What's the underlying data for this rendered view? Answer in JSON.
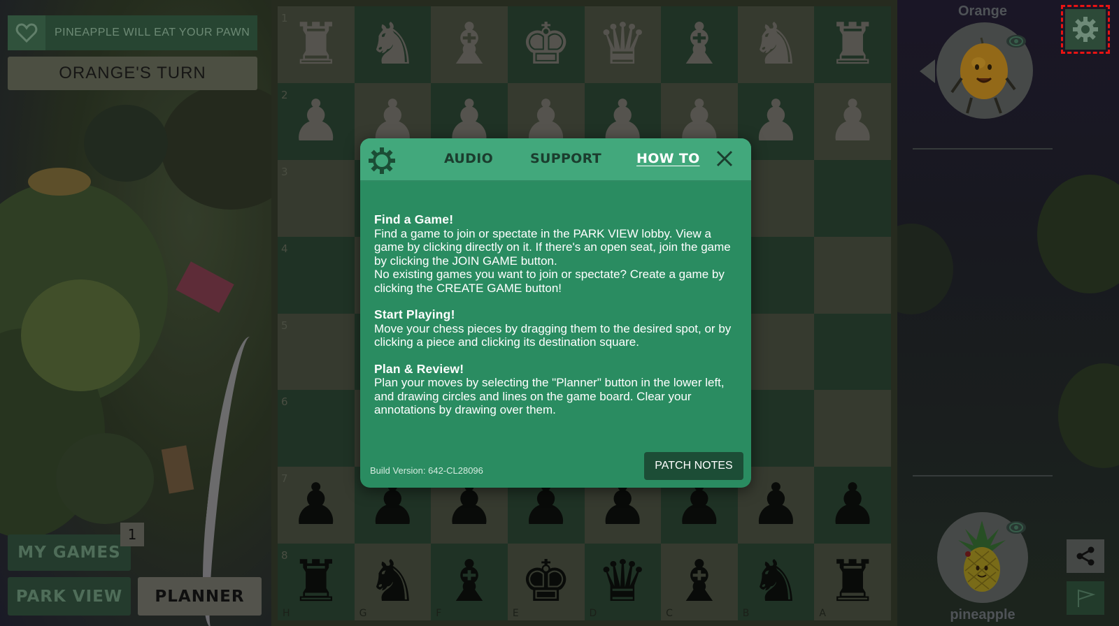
{
  "left_panel": {
    "notification_text": "PINEAPPLE WILL EAT YOUR PAWN",
    "turn_banner": "ORANGE'S TURN",
    "my_games_label": "MY GAMES",
    "my_games_count": "1",
    "park_view_label": "PARK VIEW",
    "planner_label": "PLANNER"
  },
  "board": {
    "ranks": [
      "1",
      "2",
      "3",
      "4",
      "5",
      "6",
      "7",
      "8"
    ],
    "files": [
      "H",
      "G",
      "F",
      "E",
      "D",
      "C",
      "B",
      "A"
    ],
    "rows": [
      [
        "♜w",
        "♞w",
        "♝w",
        "♚w",
        "♛w",
        "♝w",
        "♞w",
        "♜w"
      ],
      [
        "♟w",
        "♟w",
        "♟w",
        "♟w",
        "♟w",
        "♟w",
        "♟w",
        "♟w"
      ],
      [
        "",
        "",
        "",
        "",
        "",
        "",
        "",
        ""
      ],
      [
        "",
        "",
        "",
        "",
        "",
        "",
        "",
        ""
      ],
      [
        "",
        "",
        "",
        "",
        "",
        "",
        "",
        ""
      ],
      [
        "",
        "",
        "",
        "",
        "",
        "",
        "",
        ""
      ],
      [
        "♟b",
        "♟b",
        "♟b",
        "♟b",
        "♟b",
        "♟b",
        "♟b",
        "♟b"
      ],
      [
        "♜b",
        "♞b",
        "♝b",
        "♚b",
        "♛b",
        "♝b",
        "♞b",
        "♜b"
      ]
    ]
  },
  "right_panel": {
    "top_player": "Orange",
    "bottom_player": "pineapple"
  },
  "modal": {
    "tabs": {
      "audio": "AUDIO",
      "support": "SUPPORT",
      "how_to": "HOW TO"
    },
    "sections": [
      {
        "title": "Find a Game!",
        "body": "Find a game to join or spectate in the PARK VIEW lobby. View a game by clicking directly on it. If there's an open seat, join the game by clicking the JOIN GAME button.\nNo existing games you want to join or spectate? Create a game by clicking the CREATE GAME button!"
      },
      {
        "title": "Start Playing!",
        "body": "Move your chess pieces by dragging them to the desired spot, or by clicking a piece and clicking its destination square."
      },
      {
        "title": "Plan & Review!",
        "body": "Plan your moves by selecting the \"Planner\" button in the lower left, and drawing circles and lines on the game board. Clear your annotations by drawing over them."
      }
    ],
    "build_version": "Build Version: 642-CL28096",
    "patch_notes_label": "PATCH NOTES"
  },
  "colors": {
    "modal_bg": "#2a8c61",
    "modal_header": "#42a87c",
    "board_light": "#3e4336",
    "board_dark": "#243a2b",
    "highlight_box": "#e81313"
  },
  "icons": [
    "heart-icon",
    "gear-icon",
    "close-icon",
    "eye-icon",
    "share-icon",
    "flag-icon"
  ]
}
